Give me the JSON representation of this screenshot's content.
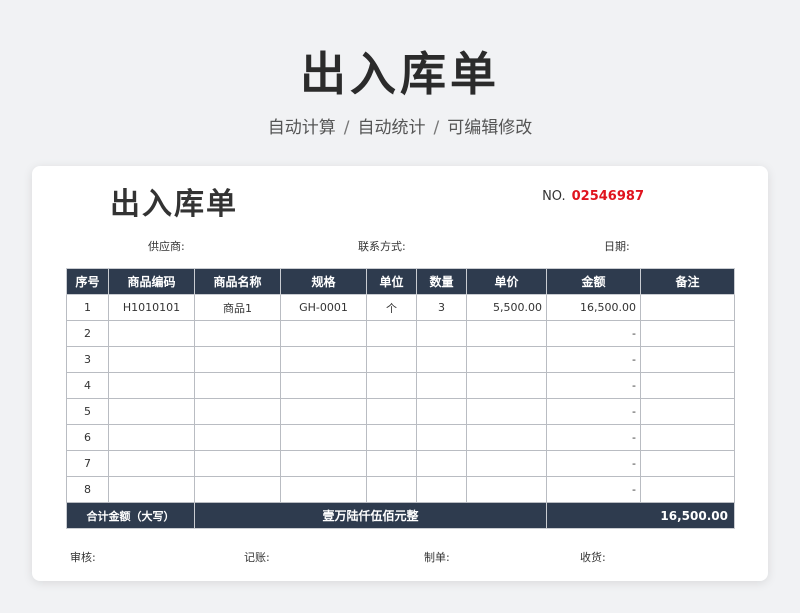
{
  "hero": {
    "title": "出入库单",
    "features": [
      "自动计算",
      "自动统计",
      "可编辑修改"
    ],
    "separator": "/"
  },
  "doc": {
    "title": "出入库单",
    "no_label": "NO.",
    "no_value": "02546987",
    "supplier_label": "供应商:",
    "contact_label": "联系方式:",
    "date_label": "日期:"
  },
  "table": {
    "headers": [
      "序号",
      "商品编码",
      "商品名称",
      "规格",
      "单位",
      "数量",
      "单价",
      "金额",
      "备注"
    ],
    "rows": [
      [
        "1",
        "H1010101",
        "商品1",
        "GH-0001",
        "个",
        "3",
        "5,500.00",
        "16,500.00",
        ""
      ],
      [
        "2",
        "",
        "",
        "",
        "",
        "",
        "",
        "-",
        ""
      ],
      [
        "3",
        "",
        "",
        "",
        "",
        "",
        "",
        "-",
        ""
      ],
      [
        "4",
        "",
        "",
        "",
        "",
        "",
        "",
        "-",
        ""
      ],
      [
        "5",
        "",
        "",
        "",
        "",
        "",
        "",
        "-",
        ""
      ],
      [
        "6",
        "",
        "",
        "",
        "",
        "",
        "",
        "-",
        ""
      ],
      [
        "7",
        "",
        "",
        "",
        "",
        "",
        "",
        "-",
        ""
      ],
      [
        "8",
        "",
        "",
        "",
        "",
        "",
        "",
        "-",
        ""
      ]
    ],
    "total_label": "合计金额（大写）",
    "total_words": "壹万陆仟伍佰元整",
    "total_amount": "16,500.00"
  },
  "signatures": {
    "review": "审核:",
    "bookkeeping": "记账:",
    "prepared": "制单:",
    "received": "收货:"
  },
  "colors": {
    "header_bg": "#2e3b4e",
    "doc_number": "#e0141e"
  }
}
